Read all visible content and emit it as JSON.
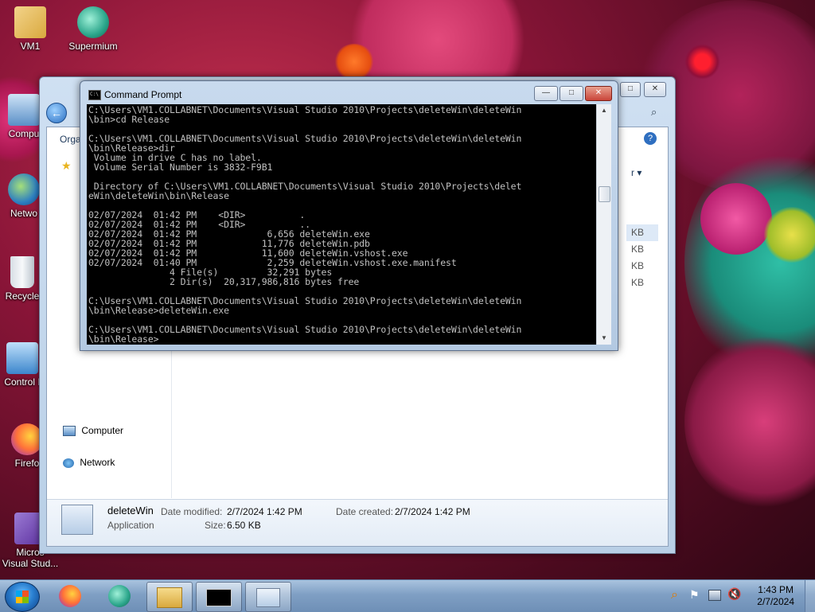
{
  "desktop": {
    "icons": [
      {
        "label": "VM1",
        "icon": "user-folder-icon"
      },
      {
        "label": "Supermium",
        "icon": "supermium-browser-icon"
      },
      {
        "label": "Compu",
        "icon": "computer-icon"
      },
      {
        "label": "Netwo",
        "icon": "network-globe-icon"
      },
      {
        "label": "Recycle",
        "icon": "recycle-bin-icon"
      },
      {
        "label": "Control I",
        "icon": "control-panel-icon"
      },
      {
        "label": "Firefo",
        "icon": "firefox-icon"
      },
      {
        "label": "Micros",
        "label2": "Visual Stud...",
        "icon": "visual-studio-icon"
      }
    ]
  },
  "explorer": {
    "toolbar_organize": "Orga",
    "sort_label": "r",
    "sizes": [
      "KB",
      "KB",
      "KB",
      "KB"
    ],
    "nav": {
      "computer": "Computer",
      "network": "Network"
    },
    "details": {
      "name": "deleteWin",
      "type": "Application",
      "modified_label": "Date modified:",
      "modified_value": "2/7/2024 1:42 PM",
      "created_label": "Date created:",
      "created_value": "2/7/2024 1:42 PM",
      "size_label": "Size:",
      "size_value": "6.50 KB"
    }
  },
  "cmd": {
    "title": "Command Prompt",
    "lines": [
      "C:\\Users\\VM1.COLLABNET\\Documents\\Visual Studio 2010\\Projects\\deleteWin\\deleteWin",
      "\\bin>cd Release",
      "",
      "C:\\Users\\VM1.COLLABNET\\Documents\\Visual Studio 2010\\Projects\\deleteWin\\deleteWin",
      "\\bin\\Release>dir",
      " Volume in drive C has no label.",
      " Volume Serial Number is 3832-F9B1",
      "",
      " Directory of C:\\Users\\VM1.COLLABNET\\Documents\\Visual Studio 2010\\Projects\\delet",
      "eWin\\deleteWin\\bin\\Release",
      "",
      "02/07/2024  01:42 PM    <DIR>          .",
      "02/07/2024  01:42 PM    <DIR>          ..",
      "02/07/2024  01:42 PM             6,656 deleteWin.exe",
      "02/07/2024  01:42 PM            11,776 deleteWin.pdb",
      "02/07/2024  01:42 PM            11,600 deleteWin.vshost.exe",
      "02/07/2024  01:40 PM             2,259 deleteWin.vshost.exe.manifest",
      "               4 File(s)         32,291 bytes",
      "               2 Dir(s)  20,317,986,816 bytes free",
      "",
      "C:\\Users\\VM1.COLLABNET\\Documents\\Visual Studio 2010\\Projects\\deleteWin\\deleteWin",
      "\\bin\\Release>deleteWin.exe",
      "",
      "C:\\Users\\VM1.COLLABNET\\Documents\\Visual Studio 2010\\Projects\\deleteWin\\deleteWin",
      "\\bin\\Release>"
    ],
    "buttons": {
      "minimize": "—",
      "maximize": "□",
      "close": "✕"
    }
  },
  "taskbar": {
    "clock_time": "1:43 PM",
    "clock_date": "2/7/2024",
    "pinned": [
      "start-orb-icon",
      "firefox-icon",
      "supermium-browser-icon",
      "windows-explorer-icon",
      "command-prompt-icon",
      "application-window-icon"
    ]
  },
  "colors": {
    "console_bg": "#000000",
    "console_fg": "#c0c0c0",
    "close_red": "#c9453a"
  }
}
